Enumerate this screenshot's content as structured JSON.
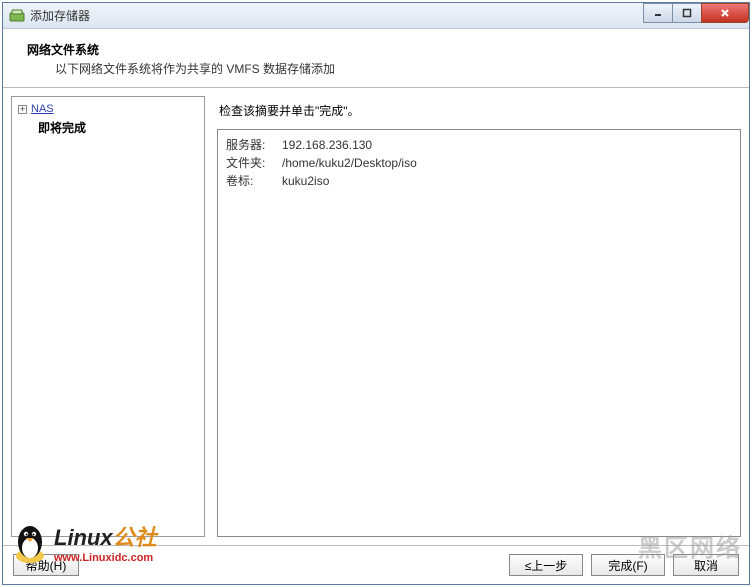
{
  "window": {
    "title": "添加存储器"
  },
  "header": {
    "title": "网络文件系统",
    "subtitle": "以下网络文件系统将作为共享的 VMFS 数据存储添加"
  },
  "sidebar": {
    "nas_label": "NAS",
    "ready_label": "即将完成"
  },
  "content": {
    "instruction": "检查该摘要并单击\"完成\"。",
    "summary": {
      "server_label": "服务器:",
      "server_value": "192.168.236.130",
      "folder_label": "文件夹:",
      "folder_value": "/home/kuku2/Desktop/iso",
      "volume_label": "卷标:",
      "volume_value": "kuku2iso"
    }
  },
  "footer": {
    "help": "帮助(H)",
    "back": "≤上一步",
    "finish": "完成(F)",
    "cancel": "取消"
  },
  "watermark": {
    "text1": "Linux",
    "text2": "公社",
    "url": "www.Linuxidc.com",
    "right": "黑区网络"
  }
}
